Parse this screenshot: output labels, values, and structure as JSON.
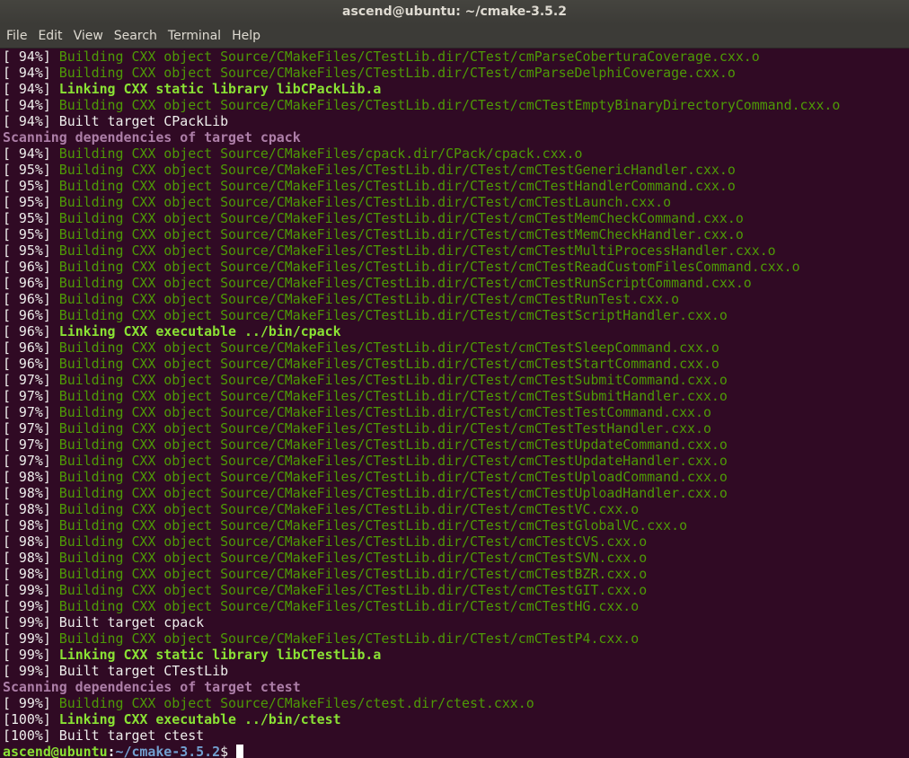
{
  "window": {
    "title": "ascend@ubuntu: ~/cmake-3.5.2"
  },
  "menu": [
    "File",
    "Edit",
    "View",
    "Search",
    "Terminal",
    "Help"
  ],
  "colors": {
    "background": "#300a24",
    "building": "#4e9a06",
    "linking": "#8ae234",
    "scanning": "#ad7fa8",
    "prompt_user": "#8ae234",
    "prompt_path": "#729fcf"
  },
  "lines": [
    {
      "type": "build",
      "pct": "[ 94%] ",
      "text": "Building CXX object Source/CMakeFiles/CTestLib.dir/CTest/cmParseCoberturaCoverage.cxx.o"
    },
    {
      "type": "build",
      "pct": "[ 94%] ",
      "text": "Building CXX object Source/CMakeFiles/CTestLib.dir/CTest/cmParseDelphiCoverage.cxx.o"
    },
    {
      "type": "link",
      "pct": "[ 94%] ",
      "text": "Linking CXX static library libCPackLib.a"
    },
    {
      "type": "build",
      "pct": "[ 94%] ",
      "text": "Building CXX object Source/CMakeFiles/CTestLib.dir/CTest/cmCTestEmptyBinaryDirectoryCommand.cxx.o"
    },
    {
      "type": "plain",
      "pct": "[ 94%] ",
      "text": "Built target CPackLib"
    },
    {
      "type": "scan",
      "pct": "",
      "text": "Scanning dependencies of target cpack"
    },
    {
      "type": "build",
      "pct": "[ 94%] ",
      "text": "Building CXX object Source/CMakeFiles/cpack.dir/CPack/cpack.cxx.o"
    },
    {
      "type": "build",
      "pct": "[ 95%] ",
      "text": "Building CXX object Source/CMakeFiles/CTestLib.dir/CTest/cmCTestGenericHandler.cxx.o"
    },
    {
      "type": "build",
      "pct": "[ 95%] ",
      "text": "Building CXX object Source/CMakeFiles/CTestLib.dir/CTest/cmCTestHandlerCommand.cxx.o"
    },
    {
      "type": "build",
      "pct": "[ 95%] ",
      "text": "Building CXX object Source/CMakeFiles/CTestLib.dir/CTest/cmCTestLaunch.cxx.o"
    },
    {
      "type": "build",
      "pct": "[ 95%] ",
      "text": "Building CXX object Source/CMakeFiles/CTestLib.dir/CTest/cmCTestMemCheckCommand.cxx.o"
    },
    {
      "type": "build",
      "pct": "[ 95%] ",
      "text": "Building CXX object Source/CMakeFiles/CTestLib.dir/CTest/cmCTestMemCheckHandler.cxx.o"
    },
    {
      "type": "build",
      "pct": "[ 95%] ",
      "text": "Building CXX object Source/CMakeFiles/CTestLib.dir/CTest/cmCTestMultiProcessHandler.cxx.o"
    },
    {
      "type": "build",
      "pct": "[ 96%] ",
      "text": "Building CXX object Source/CMakeFiles/CTestLib.dir/CTest/cmCTestReadCustomFilesCommand.cxx.o"
    },
    {
      "type": "build",
      "pct": "[ 96%] ",
      "text": "Building CXX object Source/CMakeFiles/CTestLib.dir/CTest/cmCTestRunScriptCommand.cxx.o"
    },
    {
      "type": "build",
      "pct": "[ 96%] ",
      "text": "Building CXX object Source/CMakeFiles/CTestLib.dir/CTest/cmCTestRunTest.cxx.o"
    },
    {
      "type": "build",
      "pct": "[ 96%] ",
      "text": "Building CXX object Source/CMakeFiles/CTestLib.dir/CTest/cmCTestScriptHandler.cxx.o"
    },
    {
      "type": "link",
      "pct": "[ 96%] ",
      "text": "Linking CXX executable ../bin/cpack"
    },
    {
      "type": "build",
      "pct": "[ 96%] ",
      "text": "Building CXX object Source/CMakeFiles/CTestLib.dir/CTest/cmCTestSleepCommand.cxx.o"
    },
    {
      "type": "build",
      "pct": "[ 96%] ",
      "text": "Building CXX object Source/CMakeFiles/CTestLib.dir/CTest/cmCTestStartCommand.cxx.o"
    },
    {
      "type": "build",
      "pct": "[ 97%] ",
      "text": "Building CXX object Source/CMakeFiles/CTestLib.dir/CTest/cmCTestSubmitCommand.cxx.o"
    },
    {
      "type": "build",
      "pct": "[ 97%] ",
      "text": "Building CXX object Source/CMakeFiles/CTestLib.dir/CTest/cmCTestSubmitHandler.cxx.o"
    },
    {
      "type": "build",
      "pct": "[ 97%] ",
      "text": "Building CXX object Source/CMakeFiles/CTestLib.dir/CTest/cmCTestTestCommand.cxx.o"
    },
    {
      "type": "build",
      "pct": "[ 97%] ",
      "text": "Building CXX object Source/CMakeFiles/CTestLib.dir/CTest/cmCTestTestHandler.cxx.o"
    },
    {
      "type": "build",
      "pct": "[ 97%] ",
      "text": "Building CXX object Source/CMakeFiles/CTestLib.dir/CTest/cmCTestUpdateCommand.cxx.o"
    },
    {
      "type": "build",
      "pct": "[ 97%] ",
      "text": "Building CXX object Source/CMakeFiles/CTestLib.dir/CTest/cmCTestUpdateHandler.cxx.o"
    },
    {
      "type": "build",
      "pct": "[ 98%] ",
      "text": "Building CXX object Source/CMakeFiles/CTestLib.dir/CTest/cmCTestUploadCommand.cxx.o"
    },
    {
      "type": "build",
      "pct": "[ 98%] ",
      "text": "Building CXX object Source/CMakeFiles/CTestLib.dir/CTest/cmCTestUploadHandler.cxx.o"
    },
    {
      "type": "build",
      "pct": "[ 98%] ",
      "text": "Building CXX object Source/CMakeFiles/CTestLib.dir/CTest/cmCTestVC.cxx.o"
    },
    {
      "type": "build",
      "pct": "[ 98%] ",
      "text": "Building CXX object Source/CMakeFiles/CTestLib.dir/CTest/cmCTestGlobalVC.cxx.o"
    },
    {
      "type": "build",
      "pct": "[ 98%] ",
      "text": "Building CXX object Source/CMakeFiles/CTestLib.dir/CTest/cmCTestCVS.cxx.o"
    },
    {
      "type": "build",
      "pct": "[ 98%] ",
      "text": "Building CXX object Source/CMakeFiles/CTestLib.dir/CTest/cmCTestSVN.cxx.o"
    },
    {
      "type": "build",
      "pct": "[ 98%] ",
      "text": "Building CXX object Source/CMakeFiles/CTestLib.dir/CTest/cmCTestBZR.cxx.o"
    },
    {
      "type": "build",
      "pct": "[ 99%] ",
      "text": "Building CXX object Source/CMakeFiles/CTestLib.dir/CTest/cmCTestGIT.cxx.o"
    },
    {
      "type": "build",
      "pct": "[ 99%] ",
      "text": "Building CXX object Source/CMakeFiles/CTestLib.dir/CTest/cmCTestHG.cxx.o"
    },
    {
      "type": "plain",
      "pct": "[ 99%] ",
      "text": "Built target cpack"
    },
    {
      "type": "build",
      "pct": "[ 99%] ",
      "text": "Building CXX object Source/CMakeFiles/CTestLib.dir/CTest/cmCTestP4.cxx.o"
    },
    {
      "type": "link",
      "pct": "[ 99%] ",
      "text": "Linking CXX static library libCTestLib.a"
    },
    {
      "type": "plain",
      "pct": "[ 99%] ",
      "text": "Built target CTestLib"
    },
    {
      "type": "scan",
      "pct": "",
      "text": "Scanning dependencies of target ctest"
    },
    {
      "type": "build",
      "pct": "[ 99%] ",
      "text": "Building CXX object Source/CMakeFiles/ctest.dir/ctest.cxx.o"
    },
    {
      "type": "link",
      "pct": "[100%] ",
      "text": "Linking CXX executable ../bin/ctest"
    },
    {
      "type": "plain",
      "pct": "[100%] ",
      "text": "Built target ctest"
    }
  ],
  "prompt": {
    "user_host": "ascend@ubuntu",
    "separator": ":",
    "path": "~/cmake-3.5.2",
    "symbol": "$ "
  }
}
